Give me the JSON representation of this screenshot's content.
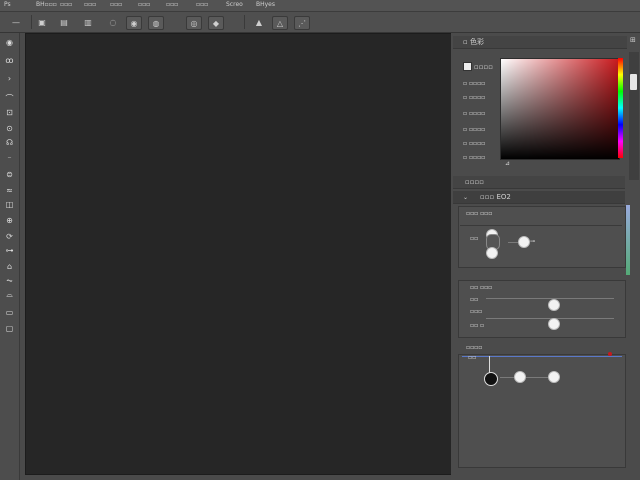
{
  "menu": {
    "items": [
      "Ps",
      "BH▫▫▫",
      "▫▫▫",
      "▫▫▫",
      "▫▫▫",
      "▫▫▫",
      "▫▫▫",
      "▫▫▫",
      "Screo",
      "BHyes"
    ]
  },
  "options": {
    "line_tool": "—",
    "buttons": [
      "▣",
      "▤",
      "▥",
      "◌",
      "◉",
      "◍",
      "◎",
      "◆",
      "▲",
      "△"
    ]
  },
  "tools": {
    "icons": [
      "move-icon",
      "lasso-icon",
      "select-icon",
      "pen-icon",
      "crop-icon",
      "eyedropper-icon",
      "heal-icon",
      "brush-icon",
      "stamp-icon",
      "history-icon",
      "eraser-icon",
      "gradient-icon",
      "blur-icon",
      "dodge-icon",
      "path-icon",
      "type-icon",
      "hand-icon",
      "zoom-icon",
      "swatch-icon"
    ]
  },
  "panel": {
    "color_tab": "▫ 色彩",
    "swatch_header": "▫▫▫▫",
    "color_rows": [
      "▫ ▫▫▫▫",
      "▫ ▫▫▫▫",
      "▫ ▫▫▫▫",
      "▫ ▫▫▫▫",
      "▫ ▫▫▫▫",
      "▫ ▫▫▫▫"
    ],
    "adjust_tab": "▫▫▫▫",
    "props_tab": "▫▫▫ EO2",
    "section1_title": "▫▫▫ ▫▫▫",
    "section1_label": "▫▫",
    "section2_title": "▫▫ ▫▫▫",
    "section2_rows": [
      "▫▫",
      "▫▫▫",
      "▫▫ ▫"
    ],
    "section3_title": "▫▫▫▫",
    "section3_label": "▫▫"
  },
  "colors": {
    "accent_red": "#c8181c",
    "guide_blue": "#5a78c8"
  }
}
